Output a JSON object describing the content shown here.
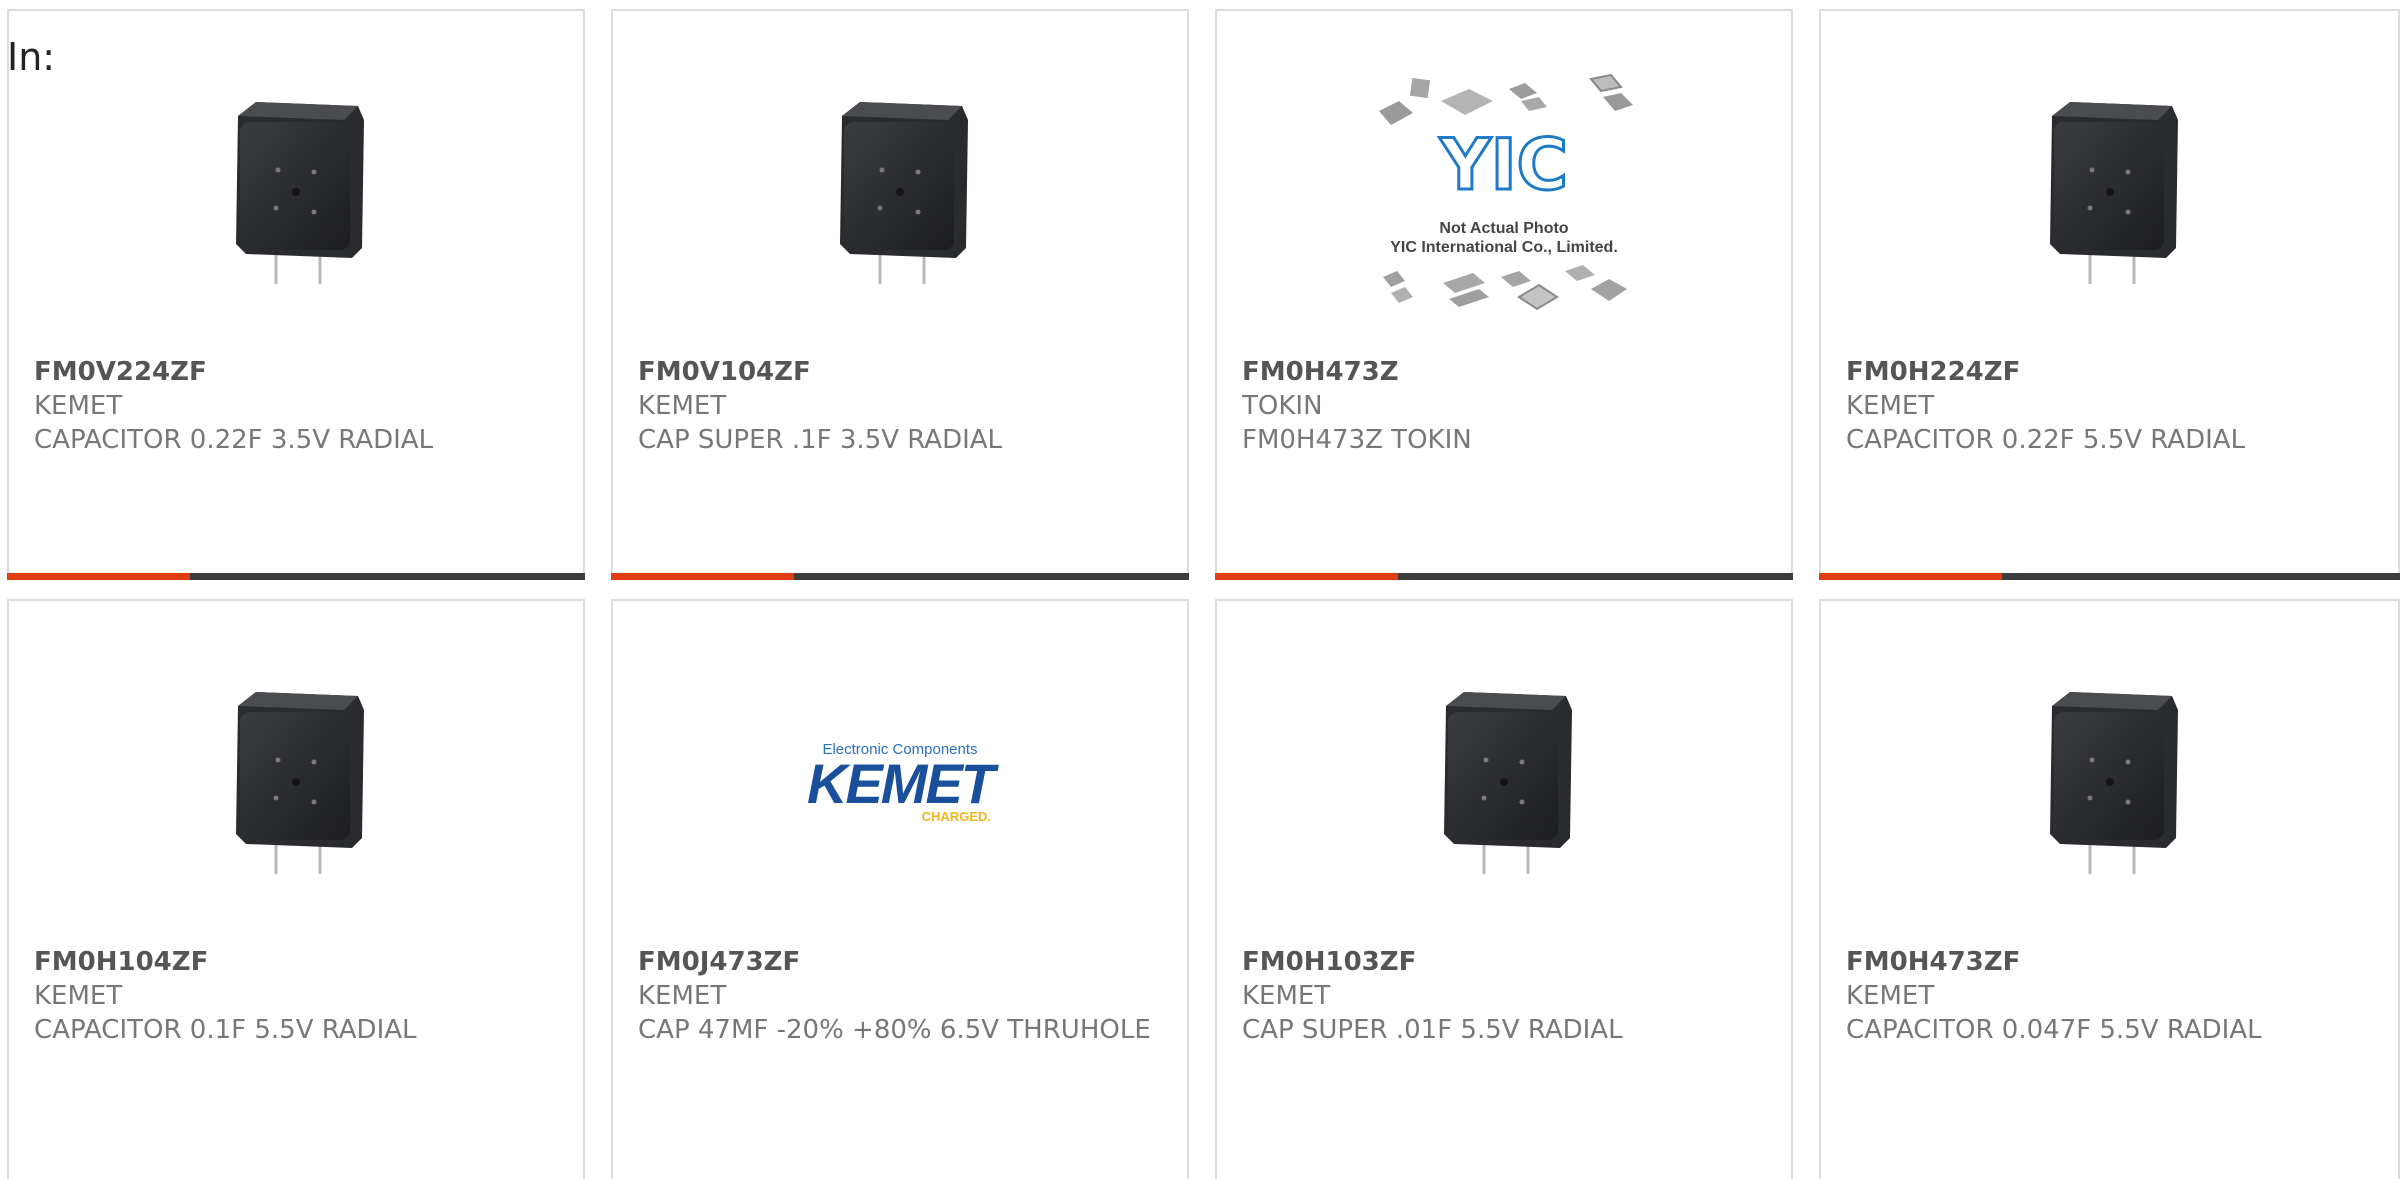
{
  "header": {
    "in_label": "In:"
  },
  "colors": {
    "accent": "#e23c12",
    "bar_dark": "#3c3c3c",
    "kemet_blue": "#1a4f9c",
    "kemet_yellow": "#f2b61c",
    "yic_blue": "#1e79c6"
  },
  "products": [
    {
      "part_number": "FM0V224ZF",
      "manufacturer": "KEMET",
      "description": "CAPACITOR 0.22F 3.5V RADIAL",
      "image": "capacitor-photo"
    },
    {
      "part_number": "FM0V104ZF",
      "manufacturer": "KEMET",
      "description": "CAP SUPER .1F 3.5V RADIAL",
      "image": "capacitor-photo"
    },
    {
      "part_number": "FM0H473Z",
      "manufacturer": "TOKIN",
      "description": "FM0H473Z TOKIN",
      "image": "yic-placeholder",
      "image_text": {
        "logo": "YIC",
        "line1": "Not Actual Photo",
        "line2": "YIC International Co., Limited."
      }
    },
    {
      "part_number": "FM0H224ZF",
      "manufacturer": "KEMET",
      "description": "CAPACITOR 0.22F 5.5V RADIAL",
      "image": "capacitor-photo"
    },
    {
      "part_number": "FM0H104ZF",
      "manufacturer": "KEMET",
      "description": "CAPACITOR 0.1F 5.5V RADIAL",
      "image": "capacitor-photo"
    },
    {
      "part_number": "FM0J473ZF",
      "manufacturer": "KEMET",
      "description": "CAP 47MF -20% +80% 6.5V THRUHOLE",
      "image": "kemet-logo",
      "image_text": {
        "top": "Electronic Components",
        "brand": "KEMET",
        "tag": "CHARGED."
      }
    },
    {
      "part_number": "FM0H103ZF",
      "manufacturer": "KEMET",
      "description": "CAP SUPER .01F 5.5V RADIAL",
      "image": "capacitor-photo"
    },
    {
      "part_number": "FM0H473ZF",
      "manufacturer": "KEMET",
      "description": "CAPACITOR 0.047F 5.5V RADIAL",
      "image": "capacitor-photo"
    }
  ]
}
